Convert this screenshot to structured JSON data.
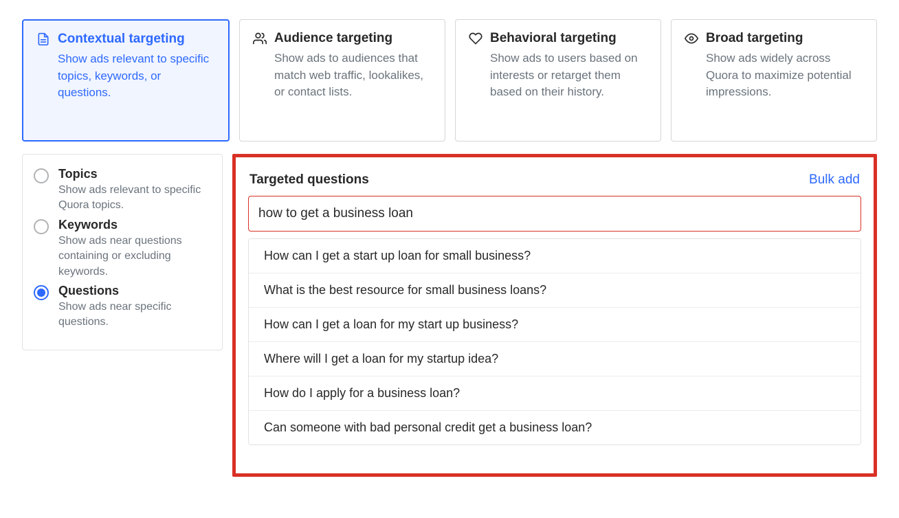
{
  "targeting_cards": [
    {
      "key": "contextual",
      "title": "Contextual targeting",
      "desc": "Show ads relevant to specific topics, keywords, or questions.",
      "selected": true
    },
    {
      "key": "audience",
      "title": "Audience targeting",
      "desc": "Show ads to audiences that match web traffic, lookalikes, or contact lists.",
      "selected": false
    },
    {
      "key": "behavioral",
      "title": "Behavioral targeting",
      "desc": "Show ads to users based on interests or retarget them based on their history.",
      "selected": false
    },
    {
      "key": "broad",
      "title": "Broad targeting",
      "desc": "Show ads widely across Quora to maximize potential impressions.",
      "selected": false
    }
  ],
  "sidebar_options": [
    {
      "key": "topics",
      "title": "Topics",
      "desc": "Show ads relevant to specific Quora topics.",
      "selected": false
    },
    {
      "key": "keywords",
      "title": "Keywords",
      "desc": "Show ads near questions containing or excluding keywords.",
      "selected": false
    },
    {
      "key": "questions",
      "title": "Questions",
      "desc": "Show ads near specific questions.",
      "selected": true
    }
  ],
  "panel": {
    "title": "Targeted questions",
    "bulk_add_label": "Bulk add",
    "search_value": "how to get a business loan",
    "suggestions": [
      "How can I get a start up loan for small business?",
      "What is the best resource for small business loans?",
      "How can I get a loan for my start up business?",
      "Where will I get a loan for my startup idea?",
      "How do I apply for a business loan?",
      "Can someone with bad personal credit get a business loan?"
    ]
  }
}
